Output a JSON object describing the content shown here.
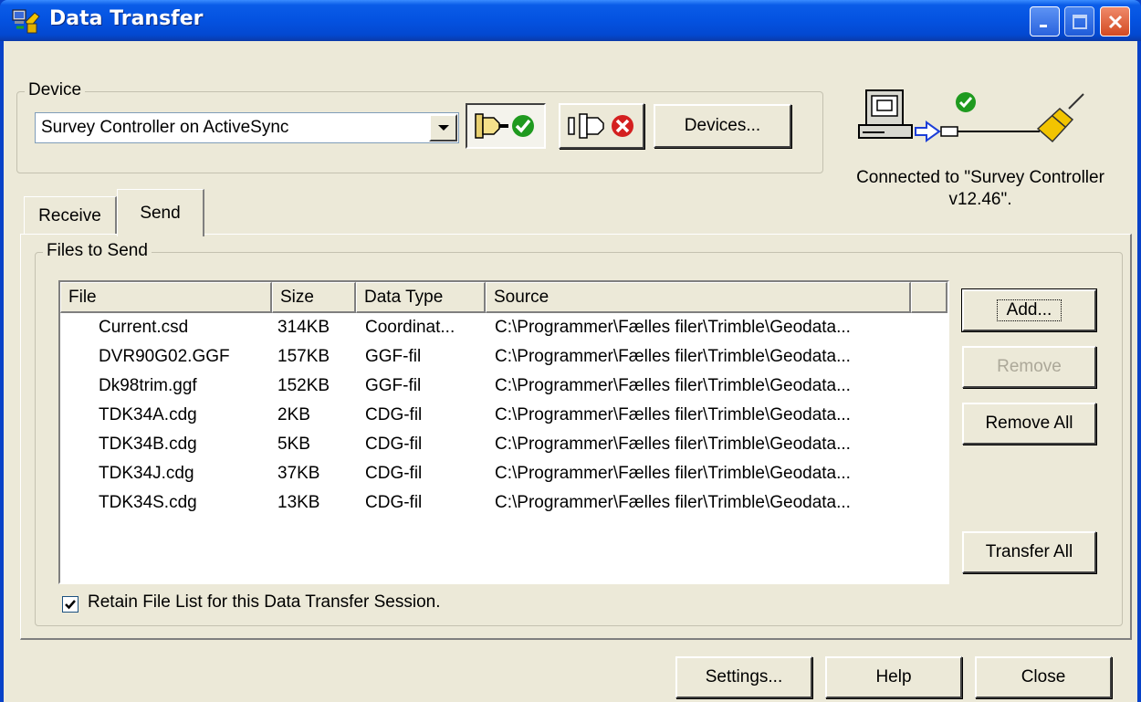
{
  "window": {
    "title": "Data Transfer"
  },
  "device": {
    "group_label": "Device",
    "selected": "Survey Controller on ActiveSync",
    "devices_button": "Devices...",
    "status": "Connected to \"Survey Controller v12.46\"."
  },
  "tabs": [
    {
      "label": "Receive",
      "active": false
    },
    {
      "label": "Send",
      "active": true
    }
  ],
  "send": {
    "group_label": "Files to Send",
    "columns": [
      "File",
      "Size",
      "Data Type",
      "Source"
    ],
    "rows": [
      {
        "file": "Current.csd",
        "size": "314KB",
        "type": "Coordinat...",
        "source": "C:\\Programmer\\Fælles filer\\Trimble\\Geodata..."
      },
      {
        "file": "DVR90G02.GGF",
        "size": "157KB",
        "type": "GGF-fil",
        "source": "C:\\Programmer\\Fælles filer\\Trimble\\Geodata..."
      },
      {
        "file": "Dk98trim.ggf",
        "size": "152KB",
        "type": "GGF-fil",
        "source": "C:\\Programmer\\Fælles filer\\Trimble\\Geodata..."
      },
      {
        "file": "TDK34A.cdg",
        "size": "2KB",
        "type": "CDG-fil",
        "source": "C:\\Programmer\\Fælles filer\\Trimble\\Geodata..."
      },
      {
        "file": "TDK34B.cdg",
        "size": "5KB",
        "type": "CDG-fil",
        "source": "C:\\Programmer\\Fælles filer\\Trimble\\Geodata..."
      },
      {
        "file": "TDK34J.cdg",
        "size": "37KB",
        "type": "CDG-fil",
        "source": "C:\\Programmer\\Fælles filer\\Trimble\\Geodata..."
      },
      {
        "file": "TDK34S.cdg",
        "size": "13KB",
        "type": "CDG-fil",
        "source": "C:\\Programmer\\Fælles filer\\Trimble\\Geodata..."
      }
    ],
    "add_button": "Add...",
    "remove_button": "Remove",
    "remove_all_button": "Remove All",
    "transfer_all_button": "Transfer All",
    "retain_checkbox": "Retain File List for this Data Transfer Session.",
    "retain_checked": true
  },
  "footer": {
    "settings_button": "Settings...",
    "help_button": "Help",
    "close_button": "Close"
  },
  "icons": {
    "app": "data-transfer-app-icon",
    "connect": "connect-plug-check-icon",
    "disconnect": "disconnect-plug-x-icon",
    "link": "pc-to-controller-connection-icon"
  },
  "colors": {
    "titlebar": "#0452e0",
    "face": "#ece9d8",
    "ok_green": "#1f9a1f",
    "err_red": "#d42020"
  }
}
